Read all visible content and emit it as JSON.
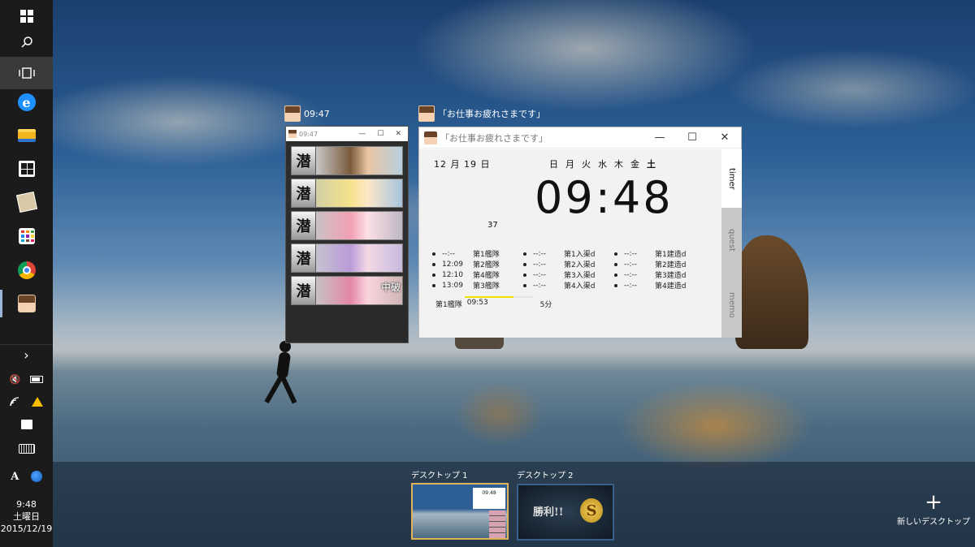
{
  "taskbar": {
    "icons": [
      "windows-logo-icon",
      "search-icon",
      "task-view-icon",
      "edge-icon",
      "file-explorer-icon",
      "store-icon",
      "maps-app-icon",
      "apps-grid-icon",
      "chrome-icon",
      "kancolle-app-icon"
    ],
    "tray": {
      "chevron": "›",
      "volume": "🔇",
      "clock_time": "9:48",
      "clock_day": "土曜日",
      "clock_date": "2015/12/19"
    }
  },
  "task_view": {
    "window1": {
      "thumbnail_title": "09:47",
      "titlebar": "09:47",
      "ships": [
        {
          "badge": "潜",
          "tag": ""
        },
        {
          "badge": "潜",
          "tag": ""
        },
        {
          "badge": "潜",
          "tag": ""
        },
        {
          "badge": "潜",
          "tag": ""
        },
        {
          "badge": "潜",
          "tag": "中破"
        }
      ]
    },
    "window2": {
      "thumbnail_title": "「お仕事お疲れさまです」",
      "titlebar": "「お仕事お疲れさまです」",
      "date": "12 月 19 日",
      "weekdays": [
        "日",
        "月",
        "火",
        "水",
        "木",
        "金",
        "土"
      ],
      "clock": "09:48",
      "seconds": "37",
      "fleets": [
        {
          "time": "--:--",
          "label": "第1艦隊"
        },
        {
          "time": "12:09",
          "label": "第2艦隊"
        },
        {
          "time": "12:10",
          "label": "第4艦隊"
        },
        {
          "time": "13:09",
          "label": "第3艦隊"
        }
      ],
      "docks": [
        {
          "time": "--:--",
          "label": "第1入渠d"
        },
        {
          "time": "--:--",
          "label": "第2入渠d"
        },
        {
          "time": "--:--",
          "label": "第3入渠d"
        },
        {
          "time": "--:--",
          "label": "第4入渠d"
        }
      ],
      "builds": [
        {
          "time": "--:--",
          "label": "第1建造d"
        },
        {
          "time": "--:--",
          "label": "第2建造d"
        },
        {
          "time": "--:--",
          "label": "第3建造d"
        },
        {
          "time": "--:--",
          "label": "第4建造d"
        }
      ],
      "footer_fleet": "第1艦隊",
      "footer_time": "09:53",
      "footer_minutes": "5分",
      "progress": 0.72,
      "tabs": [
        "timer",
        "quest",
        "memo"
      ]
    }
  },
  "desktops": {
    "items": [
      {
        "label": "デスクトップ 1",
        "mini_clock": "09:48"
      },
      {
        "label": "デスクトップ 2",
        "overlay_text": "勝利!!",
        "emblem": "S"
      }
    ],
    "new_label": "新しいデスクトップ",
    "new_symbol": "+"
  },
  "colors": {
    "active_thumb_border": "#e0b35a",
    "progress_fill": "#f2e000"
  }
}
